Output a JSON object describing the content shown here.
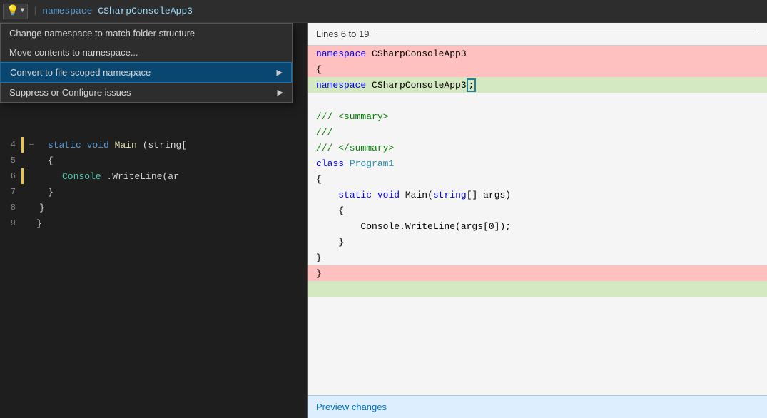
{
  "topbar": {
    "namespace_keyword": "namespace",
    "namespace_name": "CSharpConsoleApp3"
  },
  "menu": {
    "items": [
      {
        "id": "change-namespace",
        "label": "Change namespace to match folder structure",
        "hasArrow": false
      },
      {
        "id": "move-contents",
        "label": "Move contents to namespace...",
        "hasArrow": false
      },
      {
        "id": "convert-scoped",
        "label": "Convert to file-scoped namespace",
        "hasArrow": true,
        "active": true
      },
      {
        "id": "suppress-configure",
        "label": "Suppress or Configure issues",
        "hasArrow": true
      }
    ]
  },
  "code_lines": [
    {
      "num": "4",
      "hasYellow": true,
      "hasCollapse": true,
      "indent": 2,
      "tokens": [
        {
          "t": "static",
          "c": "kw-blue"
        },
        {
          "t": " "
        },
        {
          "t": "void",
          "c": "kw-blue"
        },
        {
          "t": " "
        },
        {
          "t": "Main",
          "c": "kw-white"
        },
        {
          "t": "(string["
        }
      ]
    },
    {
      "num": "5",
      "hasYellow": false,
      "hasCollapse": false,
      "indent": 2,
      "tokens": [
        {
          "t": "{",
          "c": "kw-white"
        }
      ]
    },
    {
      "num": "6",
      "hasYellow": true,
      "hasCollapse": false,
      "indent": 3,
      "tokens": [
        {
          "t": "Console",
          "c": "kw-cyan"
        },
        {
          "t": ".WriteLine(ar",
          "c": "kw-white"
        }
      ]
    },
    {
      "num": "7",
      "hasYellow": false,
      "hasCollapse": false,
      "indent": 2,
      "tokens": [
        {
          "t": "}",
          "c": "kw-white"
        }
      ]
    },
    {
      "num": "8",
      "hasYellow": false,
      "hasCollapse": false,
      "indent": 1,
      "tokens": [
        {
          "t": "}",
          "c": "kw-white"
        }
      ]
    },
    {
      "num": "9",
      "hasYellow": false,
      "hasCollapse": false,
      "indent": 0,
      "tokens": [
        {
          "t": "}",
          "c": "kw-white"
        }
      ]
    }
  ],
  "preview": {
    "header": "Lines 6 to 19",
    "lines": [
      {
        "type": "removed",
        "tokens": [
          {
            "t": "namespace",
            "c": "p-kw"
          },
          {
            "t": " CSharpConsoleApp3",
            "c": "p-default"
          }
        ]
      },
      {
        "type": "removed",
        "tokens": [
          {
            "t": "{",
            "c": "p-default"
          }
        ]
      },
      {
        "type": "added",
        "tokens": [
          {
            "t": "namespace",
            "c": "p-kw"
          },
          {
            "t": " CSharpConsoleApp3",
            "c": "p-default"
          },
          {
            "t": ";",
            "c": "p-default",
            "cursor": true
          }
        ]
      },
      {
        "type": "normal",
        "tokens": []
      },
      {
        "type": "normal",
        "tokens": [
          {
            "t": "/// <summary>",
            "c": "p-green"
          }
        ]
      },
      {
        "type": "normal",
        "tokens": [
          {
            "t": "///",
            "c": "p-green"
          }
        ]
      },
      {
        "type": "normal",
        "tokens": [
          {
            "t": "/// </summary>",
            "c": "p-green"
          }
        ]
      },
      {
        "type": "normal",
        "tokens": [
          {
            "t": "class",
            "c": "p-kw"
          },
          {
            "t": " ",
            "c": "p-default"
          },
          {
            "t": "Program1",
            "c": "p-cyan"
          }
        ]
      },
      {
        "type": "normal",
        "tokens": [
          {
            "t": "{",
            "c": "p-default"
          }
        ]
      },
      {
        "type": "normal",
        "tokens": [
          {
            "t": "    ",
            "c": "p-default"
          },
          {
            "t": "static",
            "c": "p-kw"
          },
          {
            "t": " ",
            "c": "p-default"
          },
          {
            "t": "void",
            "c": "p-kw"
          },
          {
            "t": " Main(",
            "c": "p-default"
          },
          {
            "t": "string",
            "c": "p-kw"
          },
          {
            "t": "[] args)",
            "c": "p-default"
          }
        ]
      },
      {
        "type": "normal",
        "tokens": [
          {
            "t": "    {",
            "c": "p-default"
          }
        ]
      },
      {
        "type": "normal",
        "tokens": [
          {
            "t": "        Console.WriteLine(args[0]);",
            "c": "p-default"
          }
        ]
      },
      {
        "type": "normal",
        "tokens": [
          {
            "t": "    }",
            "c": "p-default"
          }
        ]
      },
      {
        "type": "normal",
        "tokens": [
          {
            "t": "}",
            "c": "p-default"
          }
        ]
      },
      {
        "type": "removed",
        "tokens": [
          {
            "t": "}",
            "c": "p-default"
          }
        ]
      },
      {
        "type": "added",
        "tokens": []
      }
    ],
    "footer_link": "Preview changes"
  },
  "icons": {
    "lightbulb": "💡",
    "arrow_down": "▼",
    "arrow_right": "▶",
    "collapse": "—"
  }
}
